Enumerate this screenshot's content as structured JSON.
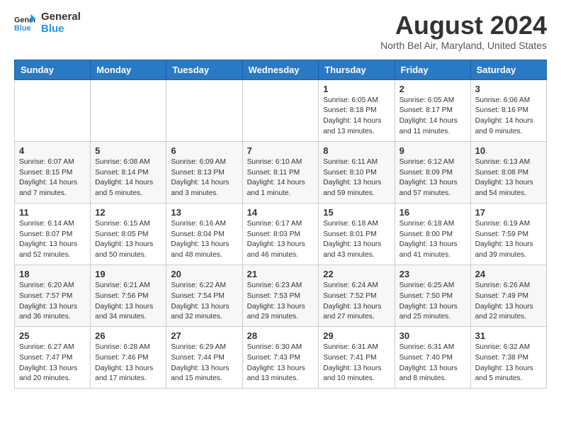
{
  "header": {
    "logo_line1": "General",
    "logo_line2": "Blue",
    "title": "August 2024",
    "subtitle": "North Bel Air, Maryland, United States"
  },
  "weekdays": [
    "Sunday",
    "Monday",
    "Tuesday",
    "Wednesday",
    "Thursday",
    "Friday",
    "Saturday"
  ],
  "weeks": [
    [
      {
        "day": "",
        "info": ""
      },
      {
        "day": "",
        "info": ""
      },
      {
        "day": "",
        "info": ""
      },
      {
        "day": "",
        "info": ""
      },
      {
        "day": "1",
        "info": "Sunrise: 6:05 AM\nSunset: 8:18 PM\nDaylight: 14 hours\nand 13 minutes."
      },
      {
        "day": "2",
        "info": "Sunrise: 6:05 AM\nSunset: 8:17 PM\nDaylight: 14 hours\nand 11 minutes."
      },
      {
        "day": "3",
        "info": "Sunrise: 6:06 AM\nSunset: 8:16 PM\nDaylight: 14 hours\nand 9 minutes."
      }
    ],
    [
      {
        "day": "4",
        "info": "Sunrise: 6:07 AM\nSunset: 8:15 PM\nDaylight: 14 hours\nand 7 minutes."
      },
      {
        "day": "5",
        "info": "Sunrise: 6:08 AM\nSunset: 8:14 PM\nDaylight: 14 hours\nand 5 minutes."
      },
      {
        "day": "6",
        "info": "Sunrise: 6:09 AM\nSunset: 8:13 PM\nDaylight: 14 hours\nand 3 minutes."
      },
      {
        "day": "7",
        "info": "Sunrise: 6:10 AM\nSunset: 8:11 PM\nDaylight: 14 hours\nand 1 minute."
      },
      {
        "day": "8",
        "info": "Sunrise: 6:11 AM\nSunset: 8:10 PM\nDaylight: 13 hours\nand 59 minutes."
      },
      {
        "day": "9",
        "info": "Sunrise: 6:12 AM\nSunset: 8:09 PM\nDaylight: 13 hours\nand 57 minutes."
      },
      {
        "day": "10",
        "info": "Sunrise: 6:13 AM\nSunset: 8:08 PM\nDaylight: 13 hours\nand 54 minutes."
      }
    ],
    [
      {
        "day": "11",
        "info": "Sunrise: 6:14 AM\nSunset: 8:07 PM\nDaylight: 13 hours\nand 52 minutes."
      },
      {
        "day": "12",
        "info": "Sunrise: 6:15 AM\nSunset: 8:05 PM\nDaylight: 13 hours\nand 50 minutes."
      },
      {
        "day": "13",
        "info": "Sunrise: 6:16 AM\nSunset: 8:04 PM\nDaylight: 13 hours\nand 48 minutes."
      },
      {
        "day": "14",
        "info": "Sunrise: 6:17 AM\nSunset: 8:03 PM\nDaylight: 13 hours\nand 46 minutes."
      },
      {
        "day": "15",
        "info": "Sunrise: 6:18 AM\nSunset: 8:01 PM\nDaylight: 13 hours\nand 43 minutes."
      },
      {
        "day": "16",
        "info": "Sunrise: 6:18 AM\nSunset: 8:00 PM\nDaylight: 13 hours\nand 41 minutes."
      },
      {
        "day": "17",
        "info": "Sunrise: 6:19 AM\nSunset: 7:59 PM\nDaylight: 13 hours\nand 39 minutes."
      }
    ],
    [
      {
        "day": "18",
        "info": "Sunrise: 6:20 AM\nSunset: 7:57 PM\nDaylight: 13 hours\nand 36 minutes."
      },
      {
        "day": "19",
        "info": "Sunrise: 6:21 AM\nSunset: 7:56 PM\nDaylight: 13 hours\nand 34 minutes."
      },
      {
        "day": "20",
        "info": "Sunrise: 6:22 AM\nSunset: 7:54 PM\nDaylight: 13 hours\nand 32 minutes."
      },
      {
        "day": "21",
        "info": "Sunrise: 6:23 AM\nSunset: 7:53 PM\nDaylight: 13 hours\nand 29 minutes."
      },
      {
        "day": "22",
        "info": "Sunrise: 6:24 AM\nSunset: 7:52 PM\nDaylight: 13 hours\nand 27 minutes."
      },
      {
        "day": "23",
        "info": "Sunrise: 6:25 AM\nSunset: 7:50 PM\nDaylight: 13 hours\nand 25 minutes."
      },
      {
        "day": "24",
        "info": "Sunrise: 6:26 AM\nSunset: 7:49 PM\nDaylight: 13 hours\nand 22 minutes."
      }
    ],
    [
      {
        "day": "25",
        "info": "Sunrise: 6:27 AM\nSunset: 7:47 PM\nDaylight: 13 hours\nand 20 minutes."
      },
      {
        "day": "26",
        "info": "Sunrise: 6:28 AM\nSunset: 7:46 PM\nDaylight: 13 hours\nand 17 minutes."
      },
      {
        "day": "27",
        "info": "Sunrise: 6:29 AM\nSunset: 7:44 PM\nDaylight: 13 hours\nand 15 minutes."
      },
      {
        "day": "28",
        "info": "Sunrise: 6:30 AM\nSunset: 7:43 PM\nDaylight: 13 hours\nand 13 minutes."
      },
      {
        "day": "29",
        "info": "Sunrise: 6:31 AM\nSunset: 7:41 PM\nDaylight: 13 hours\nand 10 minutes."
      },
      {
        "day": "30",
        "info": "Sunrise: 6:31 AM\nSunset: 7:40 PM\nDaylight: 13 hours\nand 8 minutes."
      },
      {
        "day": "31",
        "info": "Sunrise: 6:32 AM\nSunset: 7:38 PM\nDaylight: 13 hours\nand 5 minutes."
      }
    ]
  ]
}
